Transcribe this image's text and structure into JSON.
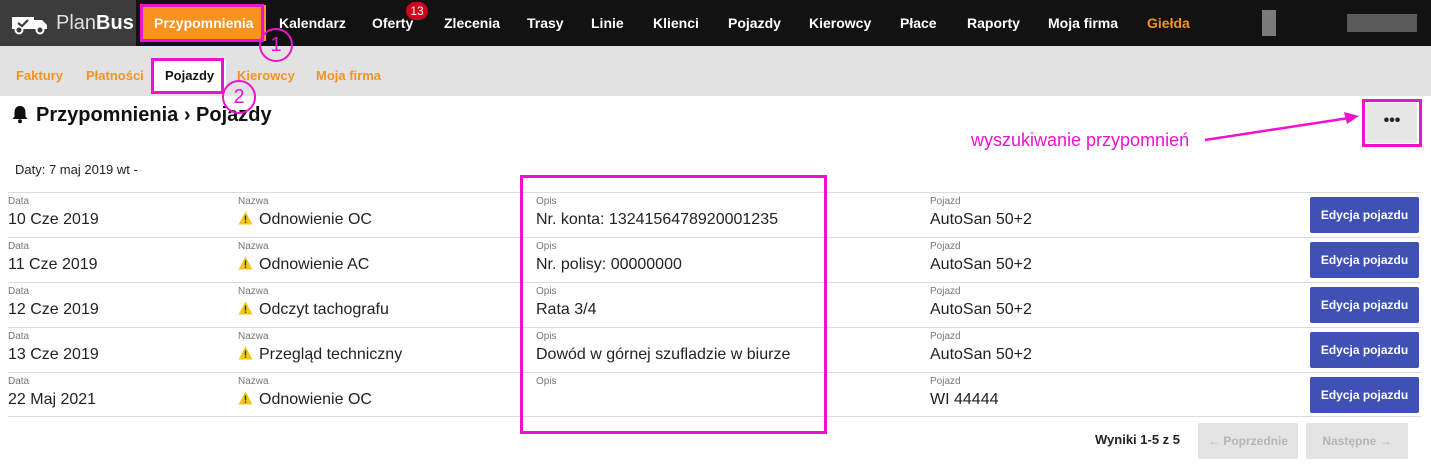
{
  "app": {
    "logo_text": "Plan",
    "logo_bold": "Bus"
  },
  "nav": {
    "items": [
      "Przypomnienia",
      "Kalendarz",
      "Oferty",
      "Zlecenia",
      "Trasy",
      "Linie",
      "Klienci",
      "Pojazdy",
      "Kierowcy",
      "Płace",
      "Raporty",
      "Moja firma",
      "Giełda"
    ],
    "badge_count": "13"
  },
  "subnav": {
    "items": [
      "Faktury",
      "Płatności",
      "Pojazdy",
      "Kierowcy",
      "Moja firma"
    ]
  },
  "page": {
    "title": "Przypomnienia › Pojazdy",
    "dates": "Daty: 7 maj 2019 wt -",
    "menu_label": "•••"
  },
  "annotations": {
    "one": "1",
    "two": "2",
    "search_hint": "wyszukiwanie przypomnień"
  },
  "table": {
    "label_date": "Data",
    "label_name": "Nazwa",
    "label_desc": "Opis",
    "label_vehicle": "Pojazd",
    "edit_label": "Edycja pojazdu",
    "rows": [
      {
        "date": "10 Cze 2019",
        "name": "Odnowienie OC",
        "desc": "Nr. konta: 1324156478920001235",
        "vehicle": "AutoSan 50+2"
      },
      {
        "date": "11 Cze 2019",
        "name": "Odnowienie AC",
        "desc": "Nr. polisy: 00000000",
        "vehicle": "AutoSan 50+2"
      },
      {
        "date": "12 Cze 2019",
        "name": "Odczyt tachografu",
        "desc": "Rata 3/4",
        "vehicle": "AutoSan 50+2"
      },
      {
        "date": "13 Cze 2019",
        "name": "Przegląd techniczny",
        "desc": "Dowód w górnej szufladzie w biurze",
        "vehicle": "AutoSan 50+2"
      },
      {
        "date": "22 Maj 2021",
        "name": "Odnowienie OC",
        "desc": "",
        "vehicle": "WI 44444"
      }
    ]
  },
  "pagination": {
    "results": "Wyniki 1-5 z 5",
    "prev": "← Poprzednie",
    "next": "Następne →"
  },
  "colors": {
    "accent": "#f7931e",
    "primary": "#3f51b5",
    "annotation": "#ee12d0",
    "warning": "#f5c518"
  },
  "icons": [
    "truck-logo-icon",
    "bell-icon",
    "warning-icon",
    "more-icon"
  ]
}
